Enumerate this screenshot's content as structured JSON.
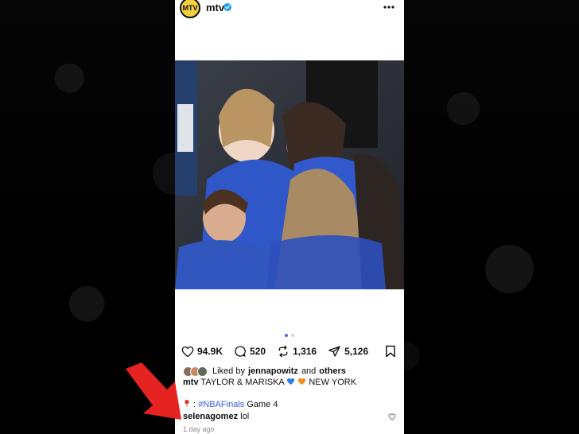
{
  "post": {
    "username": "mtv",
    "avatar_text": "MTV",
    "actions": {
      "likes": "94.9K",
      "comments": "520",
      "reposts": "1,316",
      "shares": "5,126"
    },
    "liked_by": {
      "prefix": "Liked by",
      "user": "jennapowitz",
      "middle": "and",
      "others": "others"
    },
    "caption": {
      "user": "mtv",
      "text": "TAYLOR & MARISKA",
      "suffix": "NEW YORK"
    },
    "caption_line2": {
      "hashtag": "#NBAFinals",
      "text": "Game 4"
    },
    "comment": {
      "user": "selenagomez",
      "text": "lol"
    },
    "timestamp": "1 day ago"
  },
  "colors": {
    "accent": "#3d5ad8",
    "annotation_arrow": "#e52421"
  },
  "icons": {
    "more": "more-icon",
    "like": "heart-icon",
    "comment": "comment-icon",
    "repost": "repost-icon",
    "share": "share-icon",
    "save": "bookmark-icon",
    "pin": "pin-icon",
    "arrow": "red-arrow-icon"
  }
}
